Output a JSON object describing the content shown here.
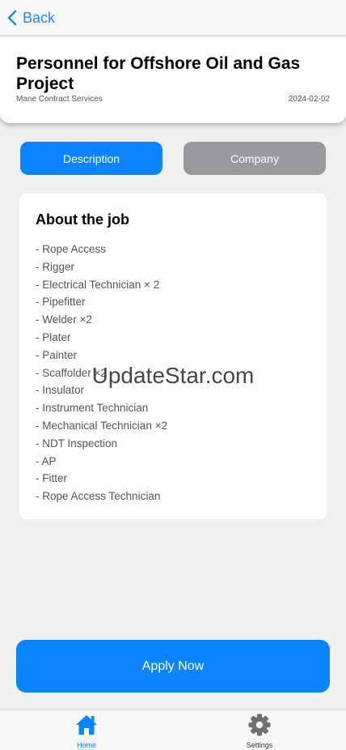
{
  "nav": {
    "back_label": "Back"
  },
  "header": {
    "title": "Personnel for Offshore Oil and Gas Project",
    "company": "Mane Contract Services",
    "date": "2024-02-02"
  },
  "tabs": {
    "description": "Description",
    "company": "Company"
  },
  "about": {
    "title": "About the job",
    "items": [
      "- Rope Access",
      "- Rigger",
      "- Electrical Technician × 2",
      "- Pipefitter",
      "- Welder ×2",
      "- Plater",
      "- Painter",
      "- Scaffolder ×2",
      "- Insulator",
      "- Instrument Technician",
      "- Mechanical Technician ×2",
      "- NDT Inspection",
      "- AP",
      "- Fitter",
      "- Rope Access Technician"
    ]
  },
  "watermark": "UpdateStar.com",
  "apply_label": "Apply Now",
  "tabbar": {
    "home": "Home",
    "settings": "Settings"
  },
  "colors": {
    "accent": "#0a84ff",
    "inactive_tab": "#98989d",
    "background": "#efefef"
  }
}
